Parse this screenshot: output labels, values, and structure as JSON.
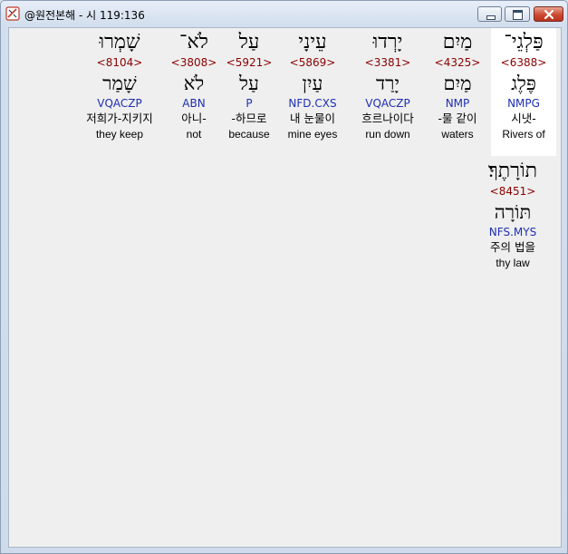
{
  "window": {
    "title": "@원전본해 - 시 119:136"
  },
  "words": [
    {
      "hebrew": "פַּלְגֵי־",
      "strong": "<6388>",
      "lemma": "פֶּלֶג",
      "morph": "NMPG",
      "korean": "시냇-",
      "english": "Rivers of",
      "selected": true
    },
    {
      "hebrew": "מַיִם",
      "strong": "<4325>",
      "lemma": "מַיִם",
      "morph": "NMP",
      "korean": "-물 같이",
      "english": "waters",
      "selected": false
    },
    {
      "hebrew": "יָרְדוּ",
      "strong": "<3381>",
      "lemma": "יָרַד",
      "morph": "VQACZP",
      "korean": "흐르나이다",
      "english": "run down",
      "selected": false
    },
    {
      "hebrew": "עֵינָי",
      "strong": "<5869>",
      "lemma": "עַיִן",
      "morph": "NFD.CXS",
      "korean": "내 눈물이",
      "english": "mine eyes",
      "selected": false
    },
    {
      "hebrew": "עַל",
      "strong": "<5921>",
      "lemma": "עַל",
      "morph": "P",
      "korean": "-하므로",
      "english": "because",
      "selected": false
    },
    {
      "hebrew": "לֹא־",
      "strong": "<3808>",
      "lemma": "לֹא",
      "morph": "ABN",
      "korean": "아니-",
      "english": "not",
      "selected": false
    },
    {
      "hebrew": "שָׁמְרוּ",
      "strong": "<8104>",
      "lemma": "שָׁמַר",
      "morph": "VQACZP",
      "korean": "저희가-지키지",
      "english": "they keep",
      "selected": false
    },
    {
      "hebrew": "תוֹרָתֶךָ׃",
      "strong": "<8451>",
      "lemma": "תּוֹרָה",
      "morph": "NFS.MYS",
      "korean": "주의 법을",
      "english": "thy law",
      "selected": false
    }
  ]
}
